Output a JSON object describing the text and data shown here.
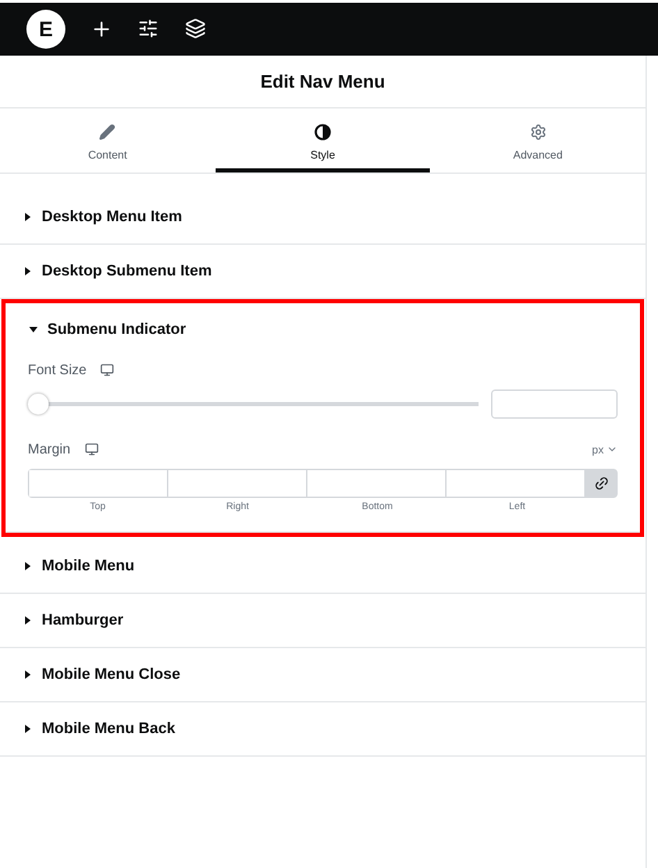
{
  "toolbar": {
    "logo": "E"
  },
  "panel": {
    "title": "Edit Nav Menu"
  },
  "tabs": [
    {
      "label": "Content",
      "kind": "pencil",
      "selected": false
    },
    {
      "label": "Style",
      "kind": "contrast",
      "selected": true
    },
    {
      "label": "Advanced",
      "kind": "gear",
      "selected": false
    }
  ],
  "sections": [
    {
      "title": "Desktop Menu Item",
      "expanded": false,
      "highlighted": false
    },
    {
      "title": "Desktop Submenu Item",
      "expanded": false,
      "highlighted": false
    },
    {
      "title": "Submenu Indicator",
      "expanded": true,
      "highlighted": true,
      "font_size": {
        "label": "Font Size",
        "level": 0
      },
      "margin": {
        "label": "Margin",
        "unit": "px",
        "linked": true,
        "sides": [
          "Top",
          "Right",
          "Bottom",
          "Left"
        ]
      }
    },
    {
      "title": "Mobile Menu",
      "expanded": false,
      "highlighted": false
    },
    {
      "title": "Hamburger",
      "expanded": false,
      "highlighted": false
    },
    {
      "title": "Mobile Menu Close",
      "expanded": false,
      "highlighted": false
    },
    {
      "title": "Mobile Menu Back",
      "expanded": false,
      "highlighted": false
    }
  ]
}
